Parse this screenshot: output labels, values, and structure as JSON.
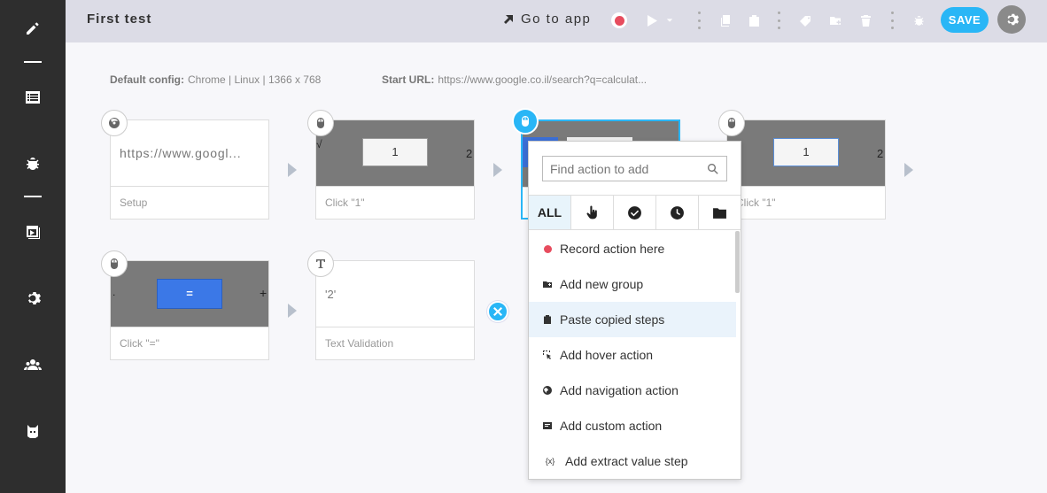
{
  "header": {
    "title": "First test",
    "goto_label": "Go to app",
    "save_label": "SAVE"
  },
  "config": {
    "default_label": "Default config:",
    "default_value": "Chrome | Linux | 1366 x 768",
    "start_label": "Start URL:",
    "start_value": "https://www.google.co.il/search?q=calculat..."
  },
  "steps": [
    {
      "caption": "Setup",
      "thumb_text": "https://www.googl..."
    },
    {
      "caption": "Click \"1\"",
      "key": "1"
    },
    {
      "caption": "",
      "key": ""
    },
    {
      "caption": "Click \"1\"",
      "key": "1"
    },
    {
      "caption": "Click \"=\"",
      "key": "="
    },
    {
      "caption": "Text Validation",
      "thumb_text": "'2'"
    }
  ],
  "thumb_fragments": {
    "sqrt": "√",
    "two": "2",
    "dot": ".",
    "plus": "+"
  },
  "dropdown": {
    "search_placeholder": "Find action to add",
    "filter_all": "ALL",
    "items": [
      {
        "label": "Record action here",
        "icon": "record-dot"
      },
      {
        "label": "Add new group",
        "icon": "group-icon"
      },
      {
        "label": "Paste copied steps",
        "icon": "clipboard-icon"
      },
      {
        "label": "Add hover action",
        "icon": "hover-icon"
      },
      {
        "label": "Add navigation action",
        "icon": "globe-icon"
      },
      {
        "label": "Add custom action",
        "icon": "code-icon"
      },
      {
        "label": "Add extract value step",
        "icon": "variable-icon"
      }
    ],
    "variable_glyph": "{x}"
  },
  "colors": {
    "accent": "#29b6f6",
    "record": "#e74c5e",
    "sidebar": "#2e2e2e",
    "topbar": "#dcdce6"
  }
}
